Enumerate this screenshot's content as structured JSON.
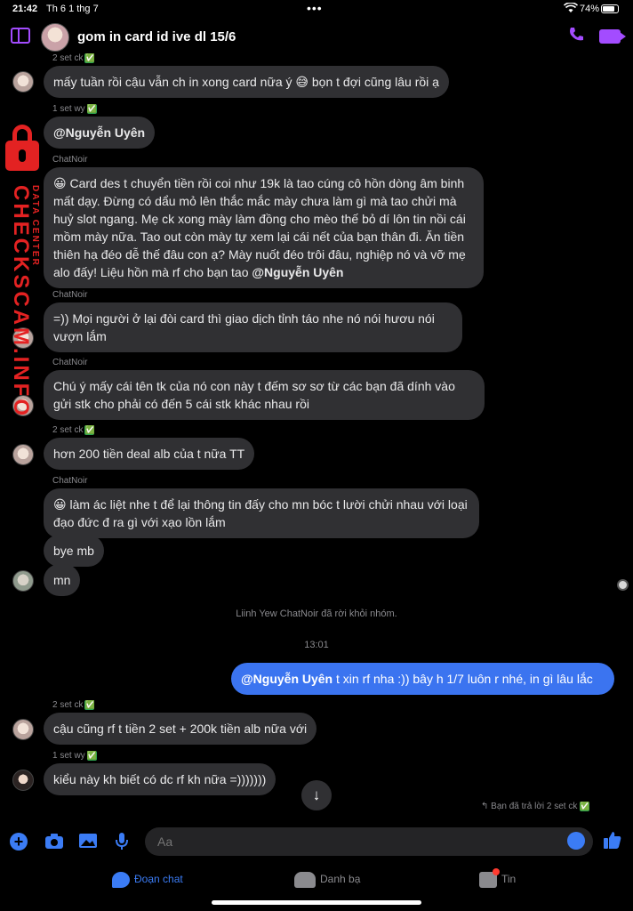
{
  "status_bar": {
    "time": "21:42",
    "date": "Th 6 1 thg 7",
    "more": "•••",
    "battery": "74%"
  },
  "header": {
    "title": "gom in card id ive dl 15/6"
  },
  "watermark": {
    "text": "CHECKSCAM.INFO",
    "sub": "DATA CENTER"
  },
  "messages": [
    {
      "sender": "2 set ck",
      "check": "✅",
      "text": "mấy tuần rồi cậu vẫn ch in xong card nữa ý 😅 bọn t đợi cũng lâu rồi ạ"
    },
    {
      "sender": "1 set wy",
      "check": "✅",
      "text": "@Nguyễn Uyên"
    },
    {
      "sender": "ChatNoir",
      "text_before": "😀 Card des t chuyển tiền rồi coi như 19k là tao cúng cô hồn dòng âm binh mất dạy. Đừng có dẩu mỏ lên thắc mắc mày chưa làm gì mà tao chửi mà huỷ slot ngang. Mẹ ck xong mày làm đồng cho mèo thế bỏ dí lôn tin nồi cái mồm mày nữa. Tao out còn mày tự xem lại cái nết của bạn thân đi. Ăn tiền thiên hạ đéo dễ thế đâu con ạ? Mày nuốt đéo trôi đâu, nghiệp nó và vỡ mẹ alo đấy! Liệu hồn mà rf cho bạn tao ",
      "mention": "@Nguyễn Uyên"
    },
    {
      "sender": "ChatNoir",
      "text": "=)) Mọi người ở lại đòi card thì giao dịch tỉnh táo nhe nó nói hươu nói vượn lắm"
    },
    {
      "sender": "ChatNoir",
      "text": "Chú ý mấy cái tên tk của nó con này t đếm sơ sơ từ các bạn đã dính vào gửi stk cho phải có đến 5 cái stk khác nhau rồi"
    },
    {
      "sender": "2 set ck",
      "check": "✅",
      "text": "hơn 200 tiền deal alb của t nữa TT"
    },
    {
      "sender": "ChatNoir",
      "text": "😀 làm ác liệt nhe t để lại thông tin đấy cho mn bóc t lười chửi nhau với loại đạo đức đ ra gì với xạo lồn lắm"
    },
    {
      "text": "bye mb"
    },
    {
      "text": "mn"
    }
  ],
  "system": {
    "left_notice": "Liinh Yew ChatNoir đã rời khỏi nhóm.",
    "timestamp": "13:01"
  },
  "my_message": {
    "mention": "@Nguyễn Uyên",
    "text": " t xin rf nha :)) bây h 1/7 luôn r nhé, in gì lâu lắc"
  },
  "later_messages": [
    {
      "sender": "2 set ck",
      "check": "✅",
      "text": "cậu cũng rf t tiền 2 set + 200k tiền alb nữa với"
    },
    {
      "sender": "1 set wy",
      "check": "✅",
      "text": "kiểu này kh biết có dc rf kh nữa =)))))))"
    }
  ],
  "reply_note": {
    "text": "Bạn đã trả lời 2 set ck",
    "check": "✅"
  },
  "composer": {
    "placeholder": "Aa"
  },
  "tabs": {
    "chats": "Đoạn chat",
    "contacts": "Danh bạ",
    "stories": "Tin"
  },
  "colors": {
    "accent": "#3b7cf5",
    "header_icon": "#a34cff",
    "watermark": "#e32222",
    "bubble": "#303033"
  }
}
